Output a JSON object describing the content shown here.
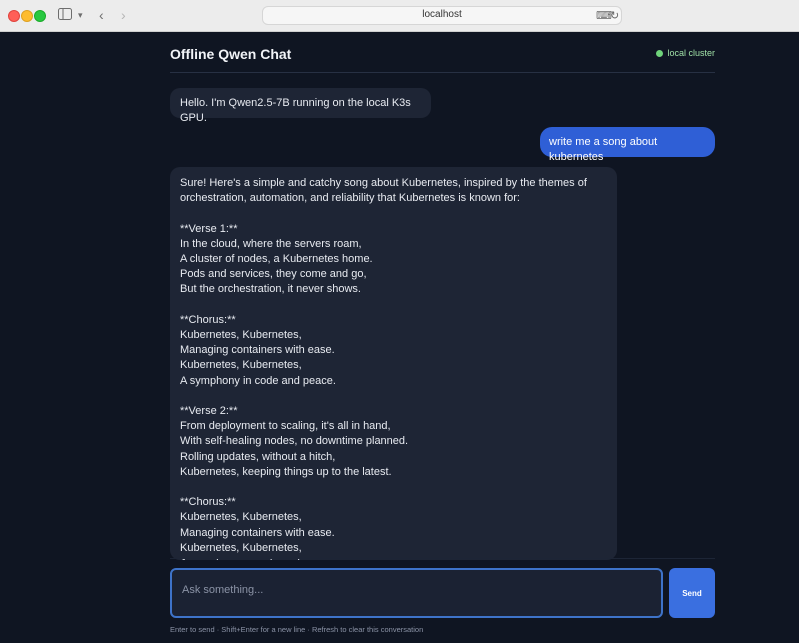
{
  "browser": {
    "url": "localhost",
    "icons": [
      "sidebar-icon",
      "chevron-down-icon",
      "back-icon",
      "forward-icon",
      "translate-icon",
      "reload-icon"
    ]
  },
  "app": {
    "title": "Offline Qwen Chat",
    "status": "local cluster",
    "status_color": "#6fd47b",
    "accent": "#3a6fe0"
  },
  "messages": [
    {
      "role": "assistant",
      "text": "Hello. I'm Qwen2.5-7B running on the local K3s GPU."
    },
    {
      "role": "user",
      "text": "write me a song about kubernetes"
    },
    {
      "role": "assistant",
      "text": "Sure! Here's a simple and catchy song about Kubernetes, inspired by the themes of orchestration, automation, and reliability that Kubernetes is known for:\n\n**Verse 1:**\nIn the cloud, where the servers roam,\nA cluster of nodes, a Kubernetes home.\nPods and services, they come and go,\nBut the orchestration, it never shows.\n\n**Chorus:**\nKubernetes, Kubernetes,\nManaging containers with ease.\nKubernetes, Kubernetes,\nA symphony in code and peace.\n\n**Verse 2:**\nFrom deployment to scaling, it's all in hand,\nWith self-healing nodes, no downtime planned.\nRolling updates, without a hitch,\nKubernetes, keeping things up to the latest.\n\n**Chorus:**\nKubernetes, Kubernetes,\nManaging containers with ease.\nKubernetes, Kubernetes,\nA symphony in code and peace."
    }
  ],
  "composer": {
    "placeholder": "Ask something...",
    "send_label": "Send",
    "hint": "Enter to send · Shift+Enter for a new line · Refresh to clear this conversation"
  }
}
